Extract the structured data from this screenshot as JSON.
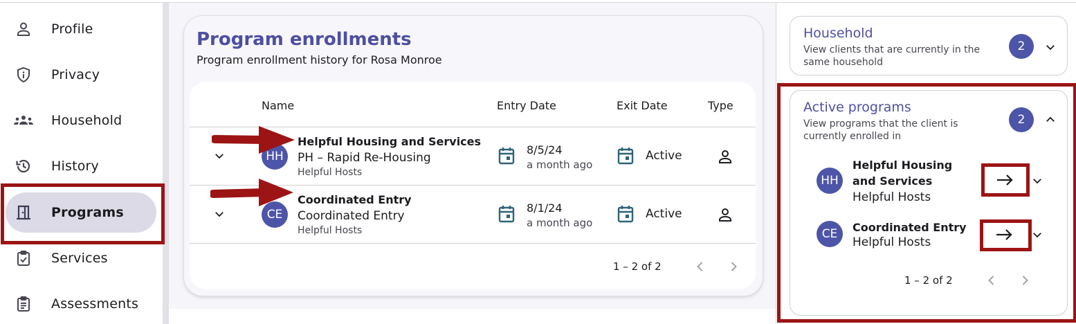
{
  "sidebar": {
    "items": [
      {
        "label": "Profile",
        "icon": "person-icon",
        "active": false
      },
      {
        "label": "Privacy",
        "icon": "shield-icon",
        "active": false
      },
      {
        "label": "Household",
        "icon": "group-icon",
        "active": false
      },
      {
        "label": "History",
        "icon": "history-icon",
        "active": true
      },
      {
        "label": "Programs",
        "icon": "door-icon",
        "active": true
      },
      {
        "label": "Services",
        "icon": "clipboard-check-icon",
        "active": false
      },
      {
        "label": "Assessments",
        "icon": "clipboard-icon",
        "active": false
      }
    ]
  },
  "enrollments": {
    "title": "Program enrollments",
    "subtitle": "Program enrollment history for Rosa Monroe",
    "columns": {
      "name": "Name",
      "entry": "Entry Date",
      "exit": "Exit Date",
      "type": "Type"
    },
    "rows": [
      {
        "initials": "HH",
        "name": "Helpful Housing and Services",
        "program_type": "PH – Rapid Re-Housing",
        "org": "Helpful Hosts",
        "entry_date": "8/5/24",
        "entry_relative": "a month ago",
        "exit": "Active"
      },
      {
        "initials": "CE",
        "name": "Coordinated Entry",
        "program_type": "Coordinated Entry",
        "org": "Helpful Hosts",
        "entry_date": "8/1/24",
        "entry_relative": "a month ago",
        "exit": "Active"
      }
    ],
    "pager": "1 – 2 of 2"
  },
  "household_panel": {
    "title": "Household",
    "description": "View clients that are currently in the same household",
    "count": "2"
  },
  "active_programs": {
    "title": "Active programs",
    "description": "View programs that the client is currently enrolled in",
    "count": "2",
    "items": [
      {
        "initials": "HH",
        "name": "Helpful Housing and Services",
        "org": "Helpful Hosts"
      },
      {
        "initials": "CE",
        "name": "Coordinated Entry",
        "org": "Helpful Hosts"
      }
    ],
    "pager": "1 – 2 of 2"
  },
  "colors": {
    "accent": "#4d4fa0",
    "avatar": "#4d55a8",
    "nav_active": "#dcdae6",
    "annotation": "#9c1414",
    "calendar_icon": "#2e6377"
  }
}
